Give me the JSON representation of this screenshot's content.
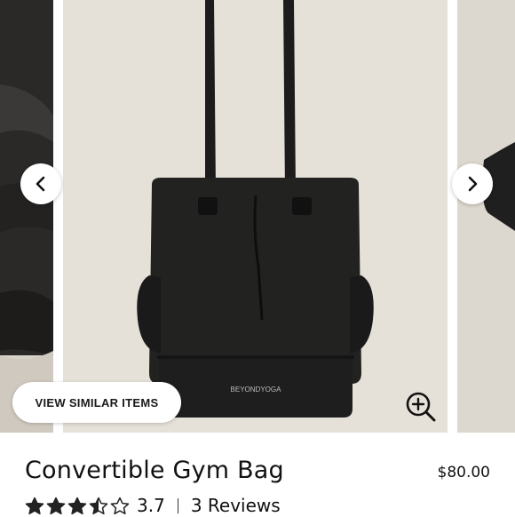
{
  "gallery": {
    "image_subject": "convertible-gym-bag-photo",
    "bag_logo_text": "BEYONDYOGA",
    "prev_icon": "chevron-left-icon",
    "next_icon": "chevron-right-icon",
    "zoom_icon": "zoom-in-icon",
    "view_similar_label": "VIEW SIMILAR ITEMS"
  },
  "product": {
    "title": "Convertible Gym Bag",
    "price": "$80.00",
    "rating": "3.7",
    "rating_fraction": 0.74,
    "stars_total": 5,
    "reviews_label": "3 Reviews"
  },
  "colors": {
    "main_image_bg": "#e6e1d8",
    "bag": "#1f1f1f",
    "text": "#111111"
  }
}
